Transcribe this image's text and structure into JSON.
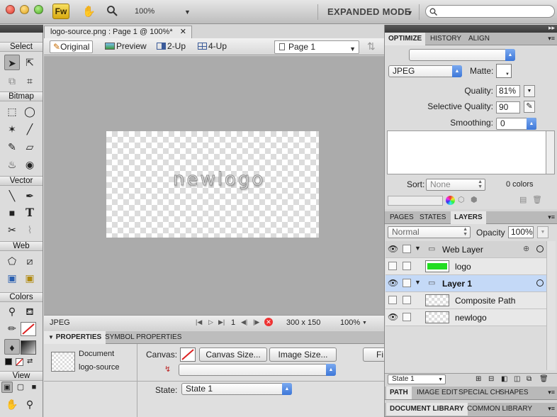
{
  "app": {
    "logo_text": "Fw",
    "zoom": "100%",
    "mode": "EXPANDED MODE"
  },
  "tools": {
    "sections": [
      "Select",
      "Bitmap",
      "Vector",
      "Web",
      "Colors",
      "View"
    ]
  },
  "document": {
    "tab_title": "logo-source.png : Page 1 @ 100%*",
    "views": [
      "Original",
      "Preview",
      "2-Up",
      "4-Up"
    ],
    "page": "Page 1",
    "canvas_text": "newlogo",
    "status": {
      "format": "JPEG",
      "frame": "1",
      "size": "300 x 150",
      "zoom": "100%"
    }
  },
  "properties": {
    "tabs": [
      "PROPERTIES",
      "SYMBOL PROPERTIES"
    ],
    "doc_type": "Document",
    "doc_name": "logo-source",
    "canvas_label": "Canvas:",
    "canvas_size_btn": "Canvas Size...",
    "image_size_btn": "Image Size...",
    "fit_btn": "Fi",
    "state_label": "State:",
    "state_value": "State 1"
  },
  "optimize": {
    "tabs": [
      "OPTIMIZE",
      "HISTORY",
      "ALIGN"
    ],
    "format": "JPEG",
    "matte_label": "Matte:",
    "quality_label": "Quality:",
    "quality_value": "81%",
    "selective_label": "Selective Quality:",
    "selective_value": "90",
    "smoothing_label": "Smoothing:",
    "smoothing_value": "0",
    "sort_label": "Sort:",
    "sort_value": "None",
    "colors_count": "0 colors"
  },
  "layers": {
    "tabs": [
      "PAGES",
      "STATES",
      "LAYERS"
    ],
    "blend": "Normal",
    "opacity_label": "Opacity",
    "opacity_value": "100%",
    "rows": [
      {
        "name": "Web Layer"
      },
      {
        "name": "logo"
      },
      {
        "name": "Layer 1"
      },
      {
        "name": "Composite Path"
      },
      {
        "name": "newlogo"
      }
    ],
    "state_select": "State 1"
  },
  "bottom_tabs": {
    "row1": [
      "PATH",
      "IMAGE EDIT",
      "SPECIAL CH",
      "SHAPES"
    ],
    "row2": [
      "DOCUMENT LIBRARY",
      "COMMON LIBRARY"
    ]
  },
  "colors": {
    "logo_fill": "#22dd22",
    "selection": "#c4d9f7"
  }
}
